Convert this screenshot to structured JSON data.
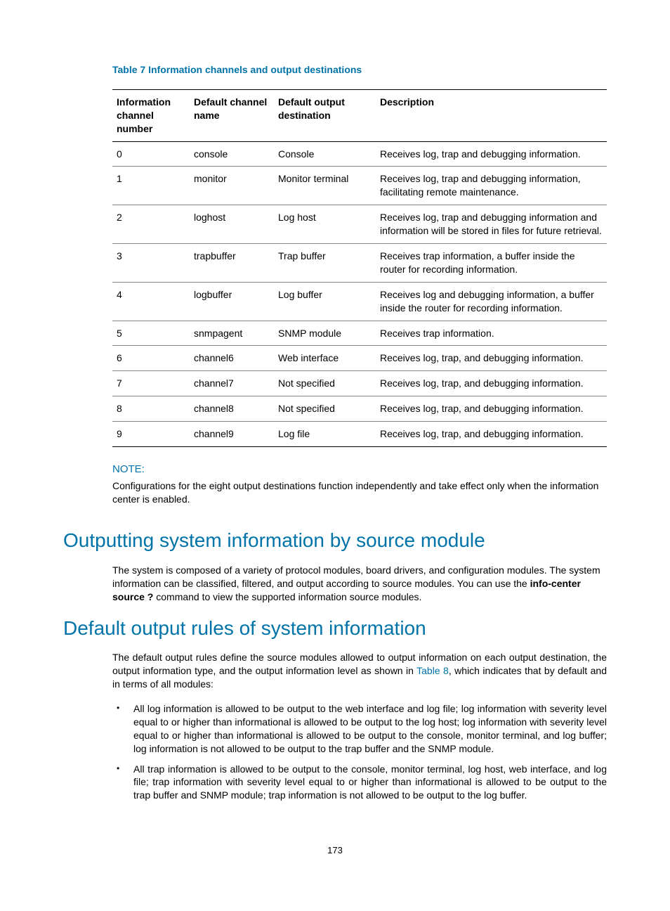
{
  "table": {
    "title": "Table 7 Information channels and output destinations",
    "headers": [
      "Information channel number",
      "Default channel name",
      "Default output destination",
      "Description"
    ],
    "rows": [
      {
        "c0": "0",
        "c1": "console",
        "c2": "Console",
        "c3": "Receives log, trap and debugging information."
      },
      {
        "c0": "1",
        "c1": "monitor",
        "c2": "Monitor terminal",
        "c3": "Receives log, trap and debugging information, facilitating remote maintenance."
      },
      {
        "c0": "2",
        "c1": "loghost",
        "c2": "Log host",
        "c3": "Receives log, trap and debugging information and information will be stored in files for future retrieval."
      },
      {
        "c0": "3",
        "c1": "trapbuffer",
        "c2": "Trap buffer",
        "c3": "Receives trap information, a buffer inside the router for recording information."
      },
      {
        "c0": "4",
        "c1": "logbuffer",
        "c2": "Log buffer",
        "c3": "Receives log and debugging information, a buffer inside the router for recording information."
      },
      {
        "c0": "5",
        "c1": "snmpagent",
        "c2": "SNMP module",
        "c3": "Receives trap information."
      },
      {
        "c0": "6",
        "c1": "channel6",
        "c2": "Web interface",
        "c3": "Receives log, trap, and debugging information."
      },
      {
        "c0": "7",
        "c1": "channel7",
        "c2": "Not specified",
        "c3": "Receives log, trap, and debugging information."
      },
      {
        "c0": "8",
        "c1": "channel8",
        "c2": "Not specified",
        "c3": "Receives log, trap, and debugging information."
      },
      {
        "c0": "9",
        "c1": "channel9",
        "c2": "Log file",
        "c3": "Receives log, trap, and debugging information."
      }
    ]
  },
  "note": {
    "label": "NOTE:",
    "text": "Configurations for the eight output destinations function independently and take effect only when the information center is enabled."
  },
  "section1": {
    "heading": "Outputting system information by source module",
    "para_pre": "The system is composed of a variety of protocol modules, board drivers, and configuration modules. The system information can be classified, filtered, and output according to source modules. You can use the ",
    "cmd": "info-center source ?",
    "para_post": " command to view the supported information source modules."
  },
  "section2": {
    "heading": "Default output rules of system information",
    "para_pre": "The default output rules define the source modules allowed to output information on each output destination, the output information type, and the output information level as shown in ",
    "link": "Table 8",
    "para_post": ", which indicates that by default and in terms of all modules:",
    "bullets": [
      "All log information is allowed to be output to the web interface and log file; log information with severity level equal to or higher than informational is allowed to be output to the log host; log information with severity level equal to or higher than informational is allowed to be output to the console, monitor terminal, and log buffer; log information is not allowed to be output to the trap buffer and the SNMP module.",
      "All trap information is allowed to be output to the console, monitor terminal, log host, web interface, and log file; trap information with severity level equal to or higher than informational is allowed to be output to the trap buffer and SNMP module; trap information is not allowed to be output to the log buffer."
    ]
  },
  "pagenum": "173"
}
